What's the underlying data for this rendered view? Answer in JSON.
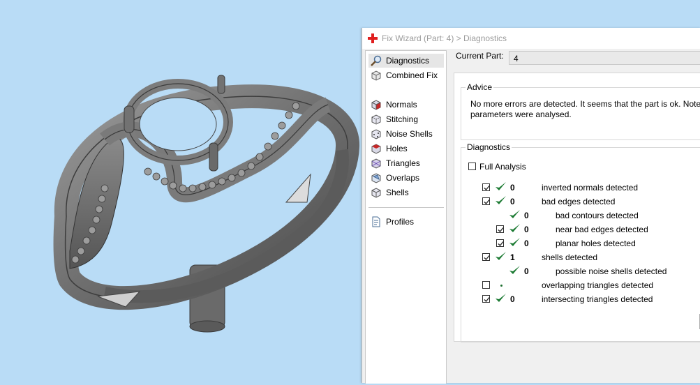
{
  "window": {
    "title": "Fix Wizard (Part: 4) > Diagnostics"
  },
  "nav": {
    "items": [
      {
        "label": "Diagnostics",
        "icon": "magnifier-icon",
        "selected": true
      },
      {
        "label": "Combined Fix",
        "icon": "combined-fix-icon"
      },
      {
        "label": "Normals",
        "icon": "normals-cube-icon"
      },
      {
        "label": "Stitching",
        "icon": "stitching-cube-icon"
      },
      {
        "label": "Noise Shells",
        "icon": "noise-shells-cube-icon"
      },
      {
        "label": "Holes",
        "icon": "holes-cube-icon"
      },
      {
        "label": "Triangles",
        "icon": "triangles-cube-icon"
      },
      {
        "label": "Overlaps",
        "icon": "overlaps-cube-icon"
      },
      {
        "label": "Shells",
        "icon": "shells-cube-icon"
      },
      {
        "label": "Profiles",
        "icon": "profiles-document-icon"
      }
    ]
  },
  "current_part": {
    "label": "Current Part:",
    "value": "4"
  },
  "advice": {
    "title": "Advice",
    "text_line1": "No more errors are detected. It seems that the part is ok. Note th",
    "text_line2": "parameters were analysed."
  },
  "diagnostics": {
    "title": "Diagnostics",
    "full_analysis_label": "Full Analysis",
    "full_analysis_checked": false,
    "rows": [
      {
        "checked": true,
        "status": "ok",
        "count": "0",
        "label": "inverted normals detected"
      },
      {
        "checked": true,
        "status": "ok",
        "count": "0",
        "label": "bad edges detected"
      },
      {
        "checked": null,
        "status": "ok",
        "count": "0",
        "label": "bad contours detected"
      },
      {
        "checked": true,
        "status": "ok",
        "count": "0",
        "label": "near bad edges detected"
      },
      {
        "checked": true,
        "status": "ok",
        "count": "0",
        "label": "planar holes detected"
      },
      {
        "checked": true,
        "status": "ok",
        "count": "1",
        "label": "shells detected"
      },
      {
        "checked": null,
        "status": "ok",
        "count": "0",
        "label": "possible noise shells detected"
      },
      {
        "checked": false,
        "status": "not-run",
        "count": "",
        "label": "overlapping triangles detected"
      },
      {
        "checked": true,
        "status": "ok",
        "count": "0",
        "label": "intersecting triangles detected"
      }
    ]
  },
  "colors": {
    "viewport_bg": "#b9dcf6",
    "ok_green": "#1b7a32",
    "title_text": "#9b9b9b",
    "app_icon_red": "#e01f1f"
  }
}
